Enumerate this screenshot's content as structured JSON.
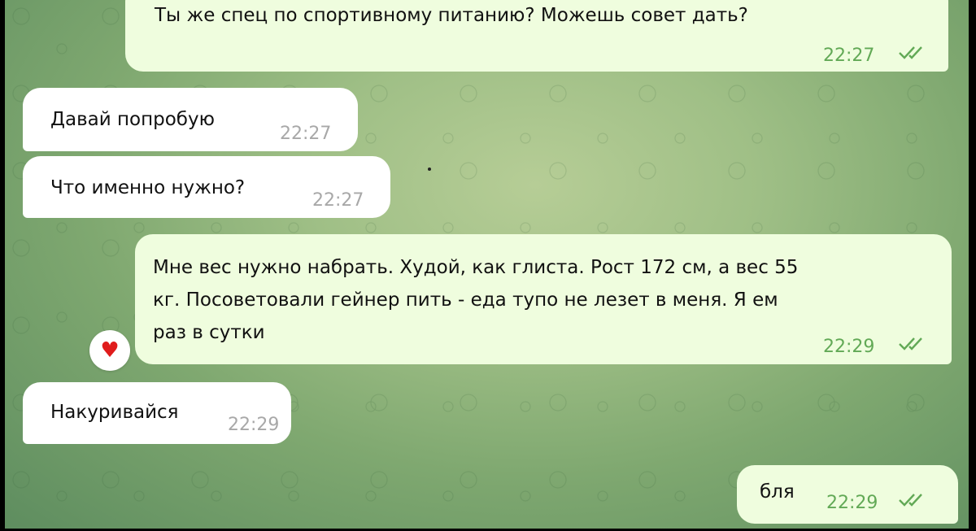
{
  "messages": [
    {
      "text": "Ты же спец по спортивному питанию? Можешь совет дать?",
      "time": "22:27",
      "direction": "out"
    },
    {
      "text": "Давай попробую",
      "time": "22:27",
      "direction": "in"
    },
    {
      "text": "Что именно нужно?",
      "time": "22:27",
      "direction": "in"
    },
    {
      "lines": [
        "Мне вес нужно набрать. Худой, как глиста. Рост 172 см, а вес 55",
        "кг. Посоветовали гейнер пить - еда тупо не лезет в меня. Я ем",
        "раз в сутки"
      ],
      "time": "22:29",
      "direction": "out",
      "reaction": "heart-icon"
    },
    {
      "text": "Накуривайся",
      "time": "22:29",
      "direction": "in"
    },
    {
      "text": "бля",
      "time": "22:29",
      "direction": "out"
    }
  ],
  "colors": {
    "incoming": "#ffffff",
    "outgoing": "#effdde",
    "time_out": "#62a956",
    "time_in": "#a8a8a8",
    "reaction": "#e01c1c"
  }
}
